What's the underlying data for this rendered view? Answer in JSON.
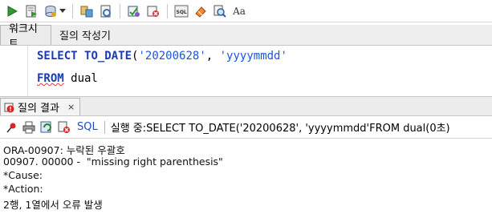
{
  "toolbar": {
    "icons": [
      "run-statement-icon",
      "run-script-icon",
      "commit-icon",
      "dropdown-arrow-icon",
      "explain-plan-icon",
      "autotrace-icon",
      "sql-tuning-icon",
      "clear-icon",
      "sql-history-icon",
      "eraser-icon",
      "find-icon",
      "format-icon"
    ],
    "format_glyph": "Aa"
  },
  "tabs": [
    {
      "label": "워크시트",
      "active": true
    },
    {
      "label": "질의 작성기",
      "active": false
    }
  ],
  "editor": {
    "line1": {
      "kw1": "SELECT",
      "fn": "TO_DATE",
      "open": "(",
      "arg1": "'20200628'",
      "comma": ", ",
      "arg2": "'yyyymmdd'"
    },
    "line2": {
      "kw": "FROM",
      "rest": " dual"
    }
  },
  "results": {
    "tab_label": "질의 결과",
    "tab_close": "×",
    "sql_label": "SQL",
    "status": "실행 중:SELECT TO_DATE('20200628', 'yyyymmdd'FROM dual(0초)"
  },
  "output": {
    "lines": [
      "ORA-00907: 누락된 우괄호",
      "00907. 00000 -  \"missing right parenthesis\"",
      "*Cause:",
      "*Action:",
      "2행, 1열에서 오류 발생"
    ]
  },
  "colors": {
    "keyword": "#1b3ab0",
    "string": "#1d56d8",
    "sql_label": "#1e4fbf"
  }
}
